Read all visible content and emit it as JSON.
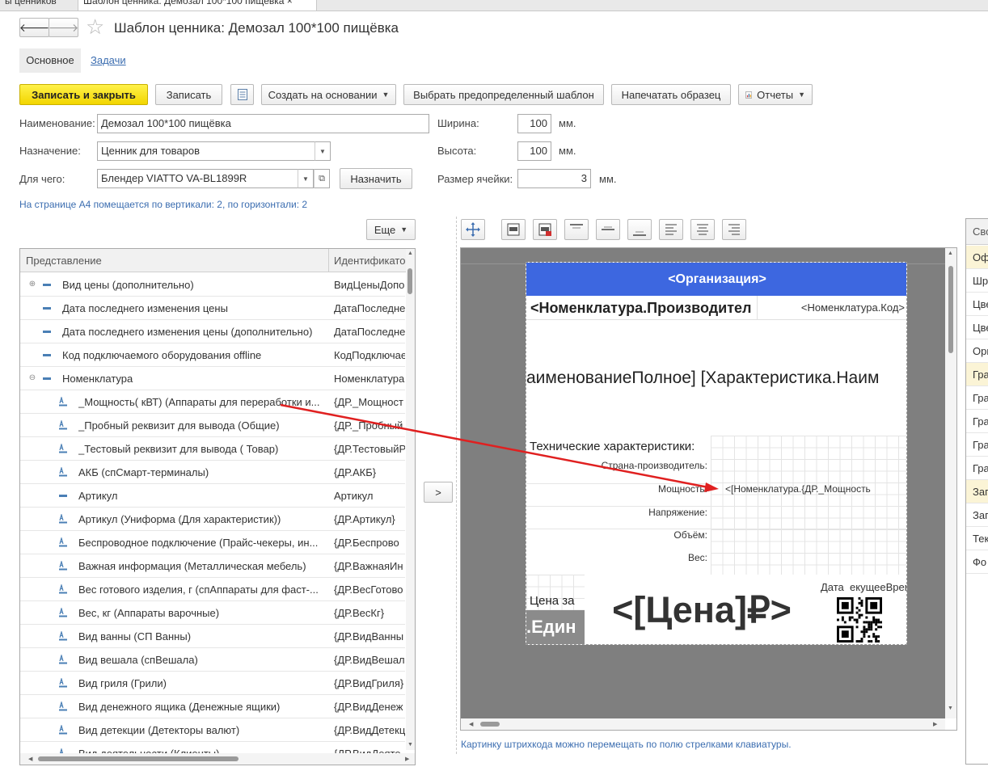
{
  "tabs": [
    {
      "label": "ы ценников"
    },
    {
      "label": "Шаблон ценника: Демозал 100*100 пищёвка ×"
    }
  ],
  "window": {
    "title": "Шаблон ценника: Демозал 100*100 пищёвка",
    "back": "🡐",
    "forward": "🡒",
    "star": "☆"
  },
  "nav": {
    "main": "Основное",
    "tasks": "Задачи"
  },
  "toolbar": {
    "save_close": "Записать и закрыть",
    "save": "Записать",
    "create_based": "Создать на основании",
    "choose_template": "Выбрать предопределенный шаблон",
    "print_sample": "Напечатать образец",
    "reports": "Отчеты"
  },
  "form": {
    "name_label": "Наименование:",
    "name_value": "Демозал 100*100 пищёвка",
    "purpose_label": "Назначение:",
    "purpose_value": "Ценник для товаров",
    "for_label": "Для чего:",
    "for_value": "Блендер VIATTO VA-BL1899R",
    "assign_button": "Назначить",
    "width_label": "Ширина:",
    "width_value": "100",
    "height_label": "Высота:",
    "height_value": "100",
    "cell_label": "Размер ячейки:",
    "cell_value": "3",
    "unit": "мм.",
    "a4_info": "На странице А4 помещается по вертикали: 2, по горизонтали: 2"
  },
  "list": {
    "more_button": "Еще",
    "col_view": "Представление",
    "col_id": "Идентификатор",
    "move_button": ">",
    "rows": [
      {
        "label": "Вид цены (дополнительно)",
        "id": "ВидЦеныДопо",
        "indent": 0,
        "icon": "dash",
        "exp": "⊕"
      },
      {
        "label": "Дата последнего изменения цены",
        "id": "ДатаПоследне",
        "indent": 0,
        "icon": "dash",
        "exp": ""
      },
      {
        "label": "Дата последнего изменения цены (дополнительно)",
        "id": "ДатаПоследне",
        "indent": 0,
        "icon": "dash",
        "exp": ""
      },
      {
        "label": "Код подключаемого оборудования offline",
        "id": "КодПодключае",
        "indent": 0,
        "icon": "dash",
        "exp": ""
      },
      {
        "label": "Номенклатура",
        "id": "Номенклатура",
        "indent": 0,
        "icon": "dash",
        "exp": "⊖"
      },
      {
        "label": "_Мощность( кВТ) (Аппараты для переработки и...",
        "id": "{ДР._Мощност",
        "indent": 1,
        "icon": "attr",
        "exp": ""
      },
      {
        "label": "_Пробный реквизит для вывода (Общие)",
        "id": "{ДР._Пробный",
        "indent": 1,
        "icon": "attr",
        "exp": ""
      },
      {
        "label": "_Тестовый реквизит для вывода ( Товар)",
        "id": "{ДР.ТестовыйР",
        "indent": 1,
        "icon": "attr",
        "exp": ""
      },
      {
        "label": "АКБ (спСмарт-терминалы)",
        "id": "{ДР.АКБ}",
        "indent": 1,
        "icon": "attr",
        "exp": ""
      },
      {
        "label": "Артикул",
        "id": "Артикул",
        "indent": 1,
        "icon": "dash",
        "exp": ""
      },
      {
        "label": "Артикул (Униформа (Для характеристик))",
        "id": "{ДР.Артикул}",
        "indent": 1,
        "icon": "attr",
        "exp": ""
      },
      {
        "label": "Беспроводное подключение (Прайс-чекеры, ин...",
        "id": "{ДР.Беспрово",
        "indent": 1,
        "icon": "attr",
        "exp": ""
      },
      {
        "label": "Важная информация (Металлическая мебель)",
        "id": "{ДР.ВажнаяИн",
        "indent": 1,
        "icon": "attr",
        "exp": ""
      },
      {
        "label": "Вес готового изделия, г (спАппараты для фаст-...",
        "id": "{ДР.ВесГотово",
        "indent": 1,
        "icon": "attr",
        "exp": ""
      },
      {
        "label": "Вес, кг (Аппараты варочные)",
        "id": "{ДР.ВесКг}",
        "indent": 1,
        "icon": "attr",
        "exp": ""
      },
      {
        "label": "Вид ванны (СП Ванны)",
        "id": "{ДР.ВидВанны",
        "indent": 1,
        "icon": "attr",
        "exp": ""
      },
      {
        "label": "Вид вешала (спВешала)",
        "id": "{ДР.ВидВешал",
        "indent": 1,
        "icon": "attr",
        "exp": ""
      },
      {
        "label": "Вид гриля (Грили)",
        "id": "{ДР.ВидГриля}",
        "indent": 1,
        "icon": "attr",
        "exp": ""
      },
      {
        "label": "Вид денежного ящика (Денежные ящики)",
        "id": "{ДР.ВидДенеж",
        "indent": 1,
        "icon": "attr",
        "exp": ""
      },
      {
        "label": "Вид детекции (Детекторы валют)",
        "id": "{ДР.ВидДетекц",
        "indent": 1,
        "icon": "attr",
        "exp": ""
      },
      {
        "label": "Вид деятельности (Клиенты)",
        "id": "{ДР.ВидДеяте",
        "indent": 1,
        "icon": "attr",
        "exp": ""
      }
    ]
  },
  "template": {
    "org": "<Организация>",
    "manufacturer": "<Номенклатура.Производител",
    "code": "<Номенклатура.Код>",
    "fullname": "аименованиеПолное] [Характеристика.Наим",
    "tech_header": "Технические характеристики:",
    "country": "Страна-производитель:",
    "power": "Мощность:",
    "power_value": "<[Номенклатура.{ДР._Мощность",
    "voltage": "Напряжение:",
    "volume": "Объём:",
    "weight": "Вес:",
    "price_for": "Цена за",
    "unit_field": ".Един",
    "price": "<[Цена]₽>",
    "date": "Дата",
    "time": "екущееВрем",
    "hint": "Картинку штрихкода можно перемещать по полю стрелками клавиатуры."
  },
  "props": {
    "header": "Сво",
    "items": [
      "Офо",
      "Шри",
      "Цве",
      "Цве",
      "Ори",
      "Гра",
      "Гра",
      "Гра",
      "Гра",
      "Гра",
      "Зап",
      "Зап",
      "Тек",
      "Фо"
    ]
  },
  "colors": {
    "accent": "#3d67e0",
    "primary_button": "#f7e01a",
    "link": "#3b6db0",
    "arrow": "#e02020"
  }
}
